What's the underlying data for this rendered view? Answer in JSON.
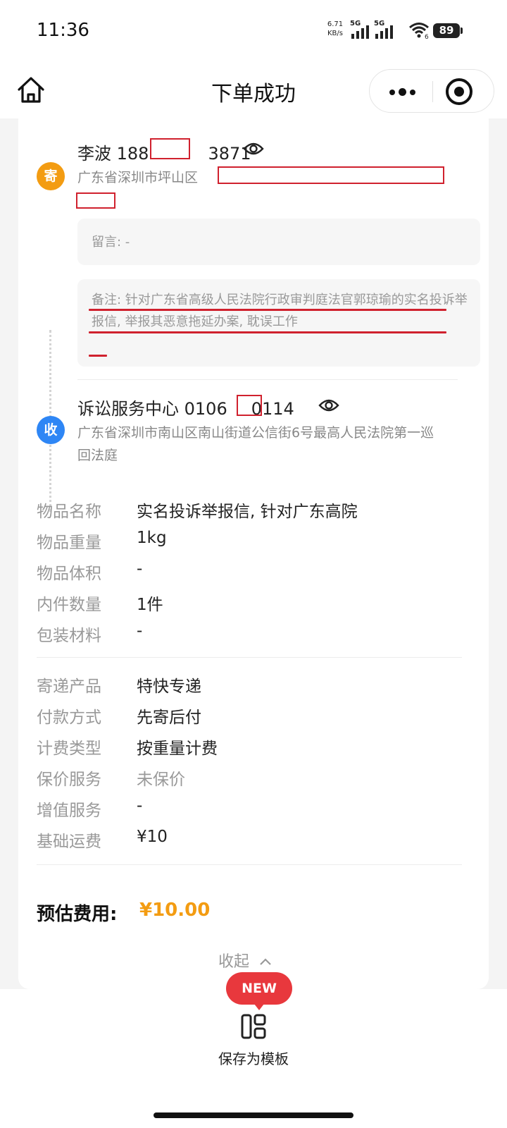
{
  "status_bar": {
    "time": "11:36",
    "net_speed_value": "6.71",
    "net_speed_unit": "KB/s",
    "sim1_label": "5G",
    "sim2_label": "5G",
    "wifi_sub": "6",
    "battery": "89"
  },
  "nav": {
    "title": "下单成功"
  },
  "sender": {
    "badge": "寄",
    "name": "李波",
    "phone_prefix": "188",
    "phone_suffix": "3871",
    "address": "广东省深圳市坪山区",
    "message": "留言: -",
    "remark": "备注: 针对广东省高级人民法院行政审判庭法官郭琼瑜的实名投诉举报信, 举报其恶意拖延办案, 耽误工作"
  },
  "receiver": {
    "badge": "收",
    "name": "诉讼服务中心",
    "phone_prefix": "0106",
    "phone_suffix": "0114",
    "address": "广东省深圳市南山区南山街道公信街6号最高人民法院第一巡回法庭"
  },
  "item_details": [
    {
      "label": "物品名称",
      "value": "实名投诉举报信, 针对广东高院"
    },
    {
      "label": "物品重量",
      "value": "1kg"
    },
    {
      "label": "物品体积",
      "value": "-"
    },
    {
      "label": "内件数量",
      "value": "1件"
    },
    {
      "label": "包装材料",
      "value": "-"
    }
  ],
  "service_details": [
    {
      "label": "寄递产品",
      "value": "特快专递"
    },
    {
      "label": "付款方式",
      "value": "先寄后付"
    },
    {
      "label": "计费类型",
      "value": "按重量计费"
    },
    {
      "label": "保价服务",
      "value": "未保价"
    },
    {
      "label": "增值服务",
      "value": "-"
    },
    {
      "label": "基础运费",
      "value": "¥10"
    }
  ],
  "estimate": {
    "label": "预估费用:",
    "value": "¥10.00"
  },
  "collapse_label": "收起",
  "bottom": {
    "new_badge": "NEW",
    "template_label": "保存为模板"
  },
  "colors": {
    "sender_badge": "#f39c12",
    "receiver_badge": "#2e86f5",
    "price": "#f39c12",
    "new_badge": "#e8383d",
    "annotation_red": "#d0212e"
  }
}
